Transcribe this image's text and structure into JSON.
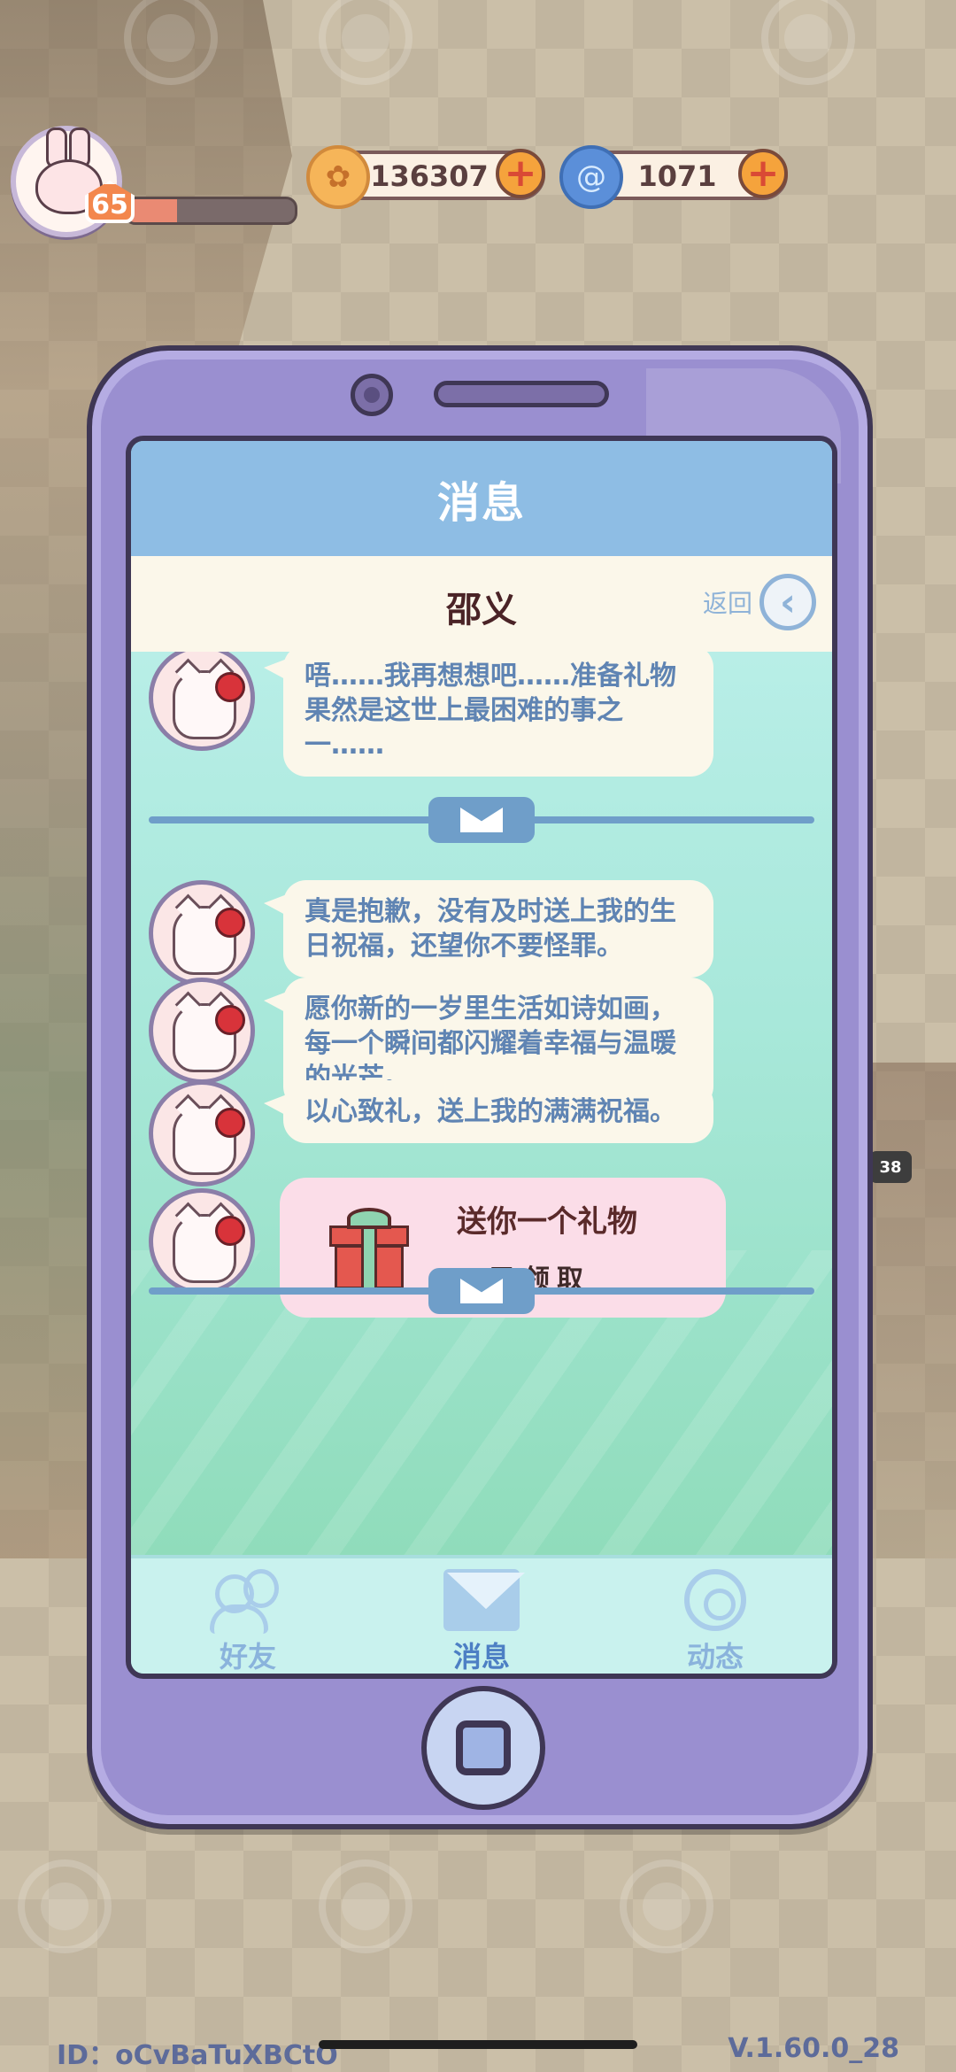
{
  "hud": {
    "level": "65",
    "xp_fraction": 0.3,
    "coins": "136307",
    "gems": "1071",
    "coin_icon": "coin-icon",
    "gem_icon": "swirl-icon"
  },
  "header": {
    "title": "消息"
  },
  "conversation": {
    "contact_name": "邵义",
    "back_label": "返回"
  },
  "messages": [
    {
      "text": "唔……我再想想吧……准备礼物果然是这世上最困难的事之一……"
    },
    {
      "text": "真是抱歉，没有及时送上我的生日祝福，还望你不要怪罪。"
    },
    {
      "text": "愿你新的一岁里生活如诗如画，每一个瞬间都闪耀着幸福与温暖的光芒。"
    },
    {
      "text": "以心致礼，送上我的满满祝福。"
    }
  ],
  "gift": {
    "title": "送你一个礼物",
    "status": "已领取"
  },
  "tabs": [
    {
      "label": "好友"
    },
    {
      "label": "消息"
    },
    {
      "label": "动态"
    }
  ],
  "footer": {
    "user_id": "ID：oCvBaTuXBCtO",
    "version": "V.1.60.0_28"
  },
  "side_badge": "38",
  "colors": {
    "phone": "#9a8fd0",
    "header": "#8ebde4",
    "bubble_text": "#5f84b3",
    "active_tab": "#4d7fc4"
  }
}
